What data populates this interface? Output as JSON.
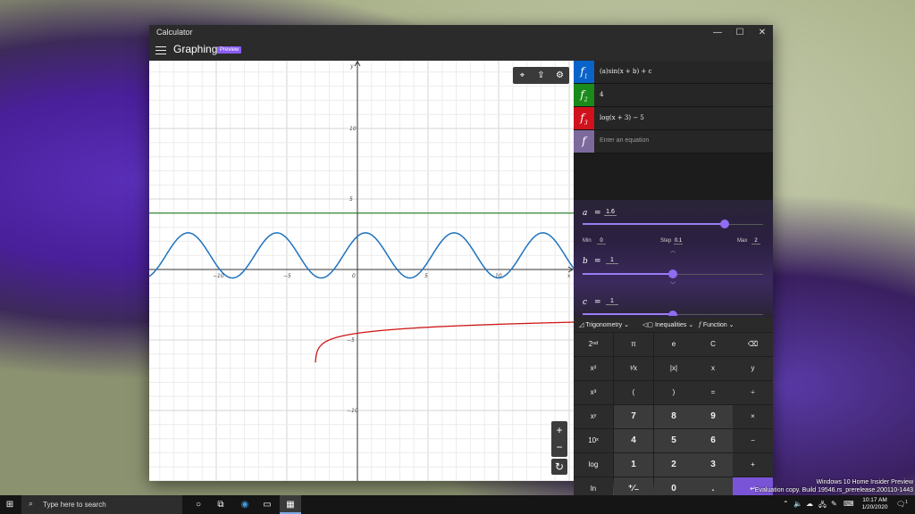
{
  "window": {
    "app_title": "Calculator",
    "minimize_icon": "minimize-icon",
    "maximize_icon": "maximize-icon",
    "close_icon": "close-icon",
    "mode_title": "Graphing",
    "mode_badge": "Preview"
  },
  "graph": {
    "x_axis_label": "x",
    "y_axis_label": "y",
    "x_ticks": [
      "−10",
      "−5",
      "0",
      "5",
      "10"
    ],
    "y_ticks": [
      "10",
      "5",
      "−5",
      "−10"
    ],
    "toolbar": [
      "trace-icon",
      "share-icon",
      "graph-options-icon"
    ],
    "zoom_in": "+",
    "zoom_out": "−",
    "reset_view": "↻",
    "colors": {
      "f1": "#1e73be",
      "f2": "#1b7a1b",
      "f3": "#d01818"
    }
  },
  "equations": [
    {
      "swatch": "f",
      "sub": "1",
      "color": "#0a63c9",
      "text": "(a)sin(x + b) + c"
    },
    {
      "swatch": "f",
      "sub": "2",
      "color": "#1a8a1a",
      "text": "4"
    },
    {
      "swatch": "f",
      "sub": "3",
      "color": "#d0121c",
      "text": "log(x + 3) − 5"
    }
  ],
  "equation_input": {
    "swatch": "f",
    "placeholder": "Enter an equation",
    "color": "#7d6a9c"
  },
  "variables": {
    "a": {
      "name": "a",
      "eq": "=",
      "value": "1.6",
      "min_label": "Min",
      "min": "0",
      "step_label": "Step",
      "step": "0.1",
      "max_label": "Max",
      "max": "2",
      "position": 0.8
    },
    "b": {
      "name": "b",
      "eq": "=",
      "value": "1",
      "position": 0.5
    },
    "c": {
      "name": "c",
      "eq": "=",
      "value": "1",
      "position": 0.5
    }
  },
  "keyboard": {
    "tabs": {
      "trigonometry": "Trigonometry",
      "inequalities": "Inequalities",
      "function": "Function"
    },
    "rows": [
      [
        "2ⁿᵈ",
        "π",
        "e",
        "C",
        "⌫"
      ],
      [
        "x²",
        "¹⁄x",
        "|x|",
        "x",
        "y"
      ],
      [
        "x³",
        "(",
        ")",
        "=",
        "÷"
      ],
      [
        "xʸ",
        "7",
        "8",
        "9",
        "×"
      ],
      [
        "10ˣ",
        "4",
        "5",
        "6",
        "−"
      ],
      [
        "log",
        "1",
        "2",
        "3",
        "+"
      ],
      [
        "ln",
        "⁺∕₋",
        "0",
        ".",
        "↵"
      ]
    ]
  },
  "watermark": {
    "line1": "Windows 10 Home Insider Preview",
    "line2": "Evaluation copy. Build 19546.rs_prerelease.200110-1443"
  },
  "taskbar": {
    "search_placeholder": "Type here to search",
    "time": "10:17 AM",
    "date": "1/20/2020",
    "notification_count": "1"
  }
}
